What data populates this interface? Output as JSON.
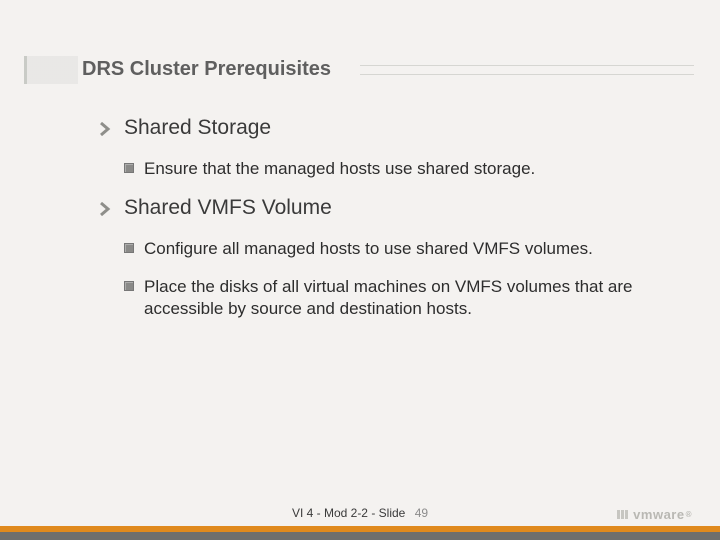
{
  "title": "DRS Cluster Prerequisites",
  "sections": [
    {
      "heading": "Shared Storage",
      "bullets": [
        "Ensure that the managed hosts use shared storage."
      ]
    },
    {
      "heading": "Shared VMFS Volume",
      "bullets": [
        "Configure all managed hosts to use shared VMFS volumes.",
        "Place the disks of all virtual machines on VMFS volumes that are accessible by source and destination hosts."
      ]
    }
  ],
  "footer": {
    "text": "VI 4 - Mod 2-2 - Slide",
    "page": "49",
    "logo": "vmware"
  }
}
